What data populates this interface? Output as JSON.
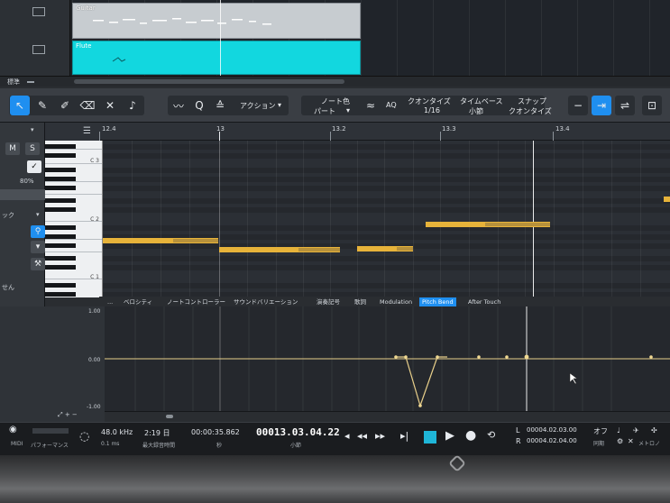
{
  "arrangement": {
    "tracks": [
      {
        "name": "Guitar",
        "color": "#c7ccd0"
      },
      {
        "name": "Flute",
        "color": "#12d7df"
      }
    ],
    "left_footer": "標準"
  },
  "toolbar": {
    "action_label": "アクション",
    "note_color_label": "ノート色",
    "note_color_value": "パート",
    "aq_label": "AQ",
    "quantize_label": "クオンタイズ",
    "quantize_value": "1/16",
    "timebase_label": "タイムベース",
    "timebase_value": "小節",
    "snap_label": "スナップ",
    "snap_value": "クオンタイズ",
    "accent_color": "#1f8ff0"
  },
  "ruler": {
    "labels": [
      "12.4",
      "13",
      "13.2",
      "13.3",
      "13.4"
    ]
  },
  "inspector": {
    "mute": "M",
    "solo": "S",
    "percent": "80%",
    "truncated_label_1": "ック",
    "truncated_label_2": "せん"
  },
  "piano": {
    "octave_labels": [
      "C 3",
      "C 2",
      "C 1"
    ]
  },
  "lane_tabs": {
    "more": "...",
    "items": [
      "ベロシティ",
      "ノートコントローラー",
      "サウンドバリエーション",
      "演奏記号",
      "歌詞",
      "Modulation",
      "Pitch Bend",
      "After Touch"
    ],
    "active": "Pitch Bend"
  },
  "controller": {
    "scale_top": "1.00",
    "scale_mid": "0.00",
    "scale_bottom": "-1.00"
  },
  "transport": {
    "midi_label": "MIDI",
    "performance_label": "パフォーマンス",
    "sample_rate": "48.0 kHz",
    "latency": "0.1 ms",
    "record_time": "2:19 日",
    "record_time_label": "最大録音時間",
    "seconds_time": "00:00:35.862",
    "seconds_label": "秒",
    "bar_position": "00013.03.04.22",
    "bar_label": "小節",
    "loop_l_label": "L",
    "loop_r_label": "R",
    "loop_l": "00004.02.03.00",
    "loop_r": "00004.02.04.00",
    "sync_label": "オフ",
    "sync_sub": "同期",
    "metro_label": "メトロノ",
    "stop_color": "#1fb6d8"
  }
}
